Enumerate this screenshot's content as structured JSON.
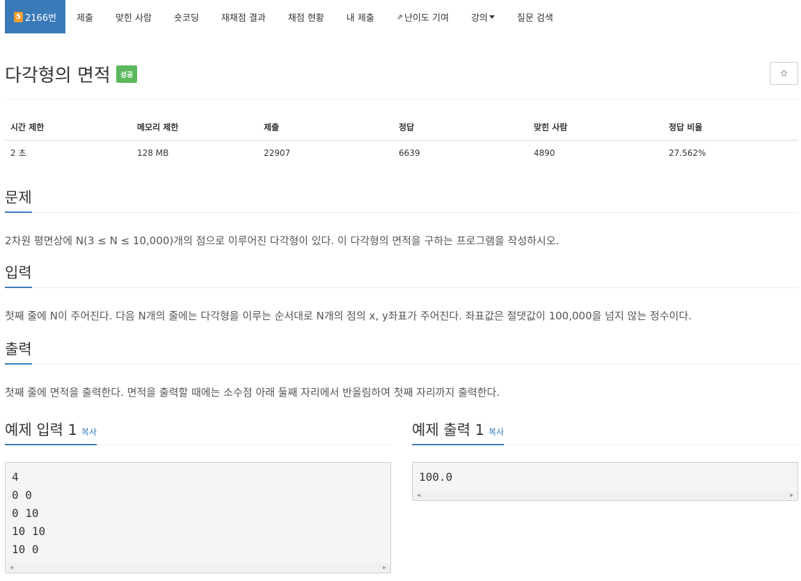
{
  "nav": {
    "problem_badge": "5",
    "problem_number": "2166번",
    "items": [
      {
        "label": "제출"
      },
      {
        "label": "맞힌 사람"
      },
      {
        "label": "숏코딩"
      },
      {
        "label": "재채점 결과"
      },
      {
        "label": "채점 현황"
      },
      {
        "label": "내 제출"
      },
      {
        "label": "난이도 기여"
      },
      {
        "label": "강의"
      },
      {
        "label": "질문 검색"
      }
    ]
  },
  "problem": {
    "title": "다각형의 면적",
    "status_label": "성공",
    "star": "☆"
  },
  "info_table": {
    "headers": [
      "시간 제한",
      "메모리 제한",
      "제출",
      "정답",
      "맞힌 사람",
      "정답 비율"
    ],
    "values": [
      "2 초",
      "128 MB",
      "22907",
      "6639",
      "4890",
      "27.562%"
    ]
  },
  "sections": {
    "problem_heading": "문제",
    "problem_text": "2차원 평면상에 N(3 ≤ N ≤ 10,000)개의 점으로 이루어진 다각형이 있다. 이 다각형의 면적을 구하는 프로그램을 작성하시오.",
    "input_heading": "입력",
    "input_text": "첫째 줄에 N이 주어진다. 다음 N개의 줄에는 다각형을 이루는 순서대로 N개의 점의 x, y좌표가 주어진다. 좌표값은 절댓값이 100,000을 넘지 않는 정수이다.",
    "output_heading": "출력",
    "output_text": "첫째 줄에 면적을 출력한다. 면적을 출력할 때에는 소수점 아래 둘째 자리에서 반올림하여 첫째 자리까지 출력한다."
  },
  "examples": {
    "input_heading": "예제 입력 1",
    "output_heading": "예제 출력 1",
    "copy_label": "복사",
    "input_sample": "4\n0 0\n0 10\n10 10\n10 0",
    "output_sample": "100.0"
  }
}
